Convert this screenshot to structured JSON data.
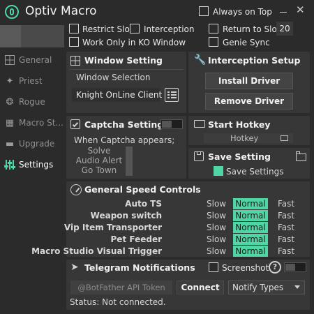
{
  "app": {
    "title": "Optiv Macro"
  },
  "window_controls": {
    "always_on_top": "Always on Top",
    "minimize": "—",
    "close": "✕"
  },
  "top_options": {
    "restrict_slot": "Restrict Slot",
    "interception": "Interception",
    "return_to_slot": "Return to Slot",
    "return_to_slot_value": "20",
    "work_only_in_ko": "Work Only in KO Window",
    "genie_sync": "Genie Sync"
  },
  "sidebar": {
    "items": [
      {
        "label": "General",
        "icon": "grid-icon",
        "active": false
      },
      {
        "label": "Priest",
        "icon": "priest-icon",
        "active": false
      },
      {
        "label": "Rogue",
        "icon": "rogue-icon",
        "active": false
      },
      {
        "label": "Macro St...",
        "icon": "film-icon",
        "active": false
      },
      {
        "label": "Upgrade",
        "icon": "anvil-icon",
        "active": false
      },
      {
        "label": "Settings",
        "icon": "sliders-icon",
        "active": true
      }
    ]
  },
  "window_setting": {
    "title": "Window Setting",
    "selection_label": "Window Selection",
    "selected_window": "Knight OnLine Client"
  },
  "interception_setup": {
    "title": "Interception Setup",
    "install_label": "Install Driver",
    "remove_label": "Remove Driver"
  },
  "captcha_setting": {
    "title": "Captcha Setting",
    "when_label": "When Captcha appears;",
    "options": [
      "Solve",
      "Audio Alert",
      "Go Town"
    ]
  },
  "start_hotkey": {
    "title": "Start Hotkey",
    "value": "Hotkey"
  },
  "save_setting": {
    "title": "Save Setting",
    "checkbox_label": "Save Settings"
  },
  "speed_controls": {
    "title": "General Speed Controls",
    "slow": "Slow",
    "normal": "Normal",
    "fast": "Fast",
    "rows": [
      {
        "name": "Auto TS",
        "level": "Normal"
      },
      {
        "name": "Weapon switch",
        "level": "Normal"
      },
      {
        "name": "Vip Item Transporter",
        "level": "Normal"
      },
      {
        "name": "Pet Feeder",
        "level": "Normal"
      },
      {
        "name": "Macro Studio Visual Trigger",
        "level": "Normal"
      }
    ]
  },
  "telegram": {
    "title": "Telegram Notifications",
    "screenshot_label": "Screenshot",
    "help": "?",
    "token_placeholder": "@BotFather API Token",
    "connect_label": "Connect",
    "notify_types": "Notify Types",
    "status": "Status: Not connected."
  },
  "colors": {
    "accent": "#4fd6a4",
    "background": "#2b2b2b",
    "panel": "#373737"
  }
}
